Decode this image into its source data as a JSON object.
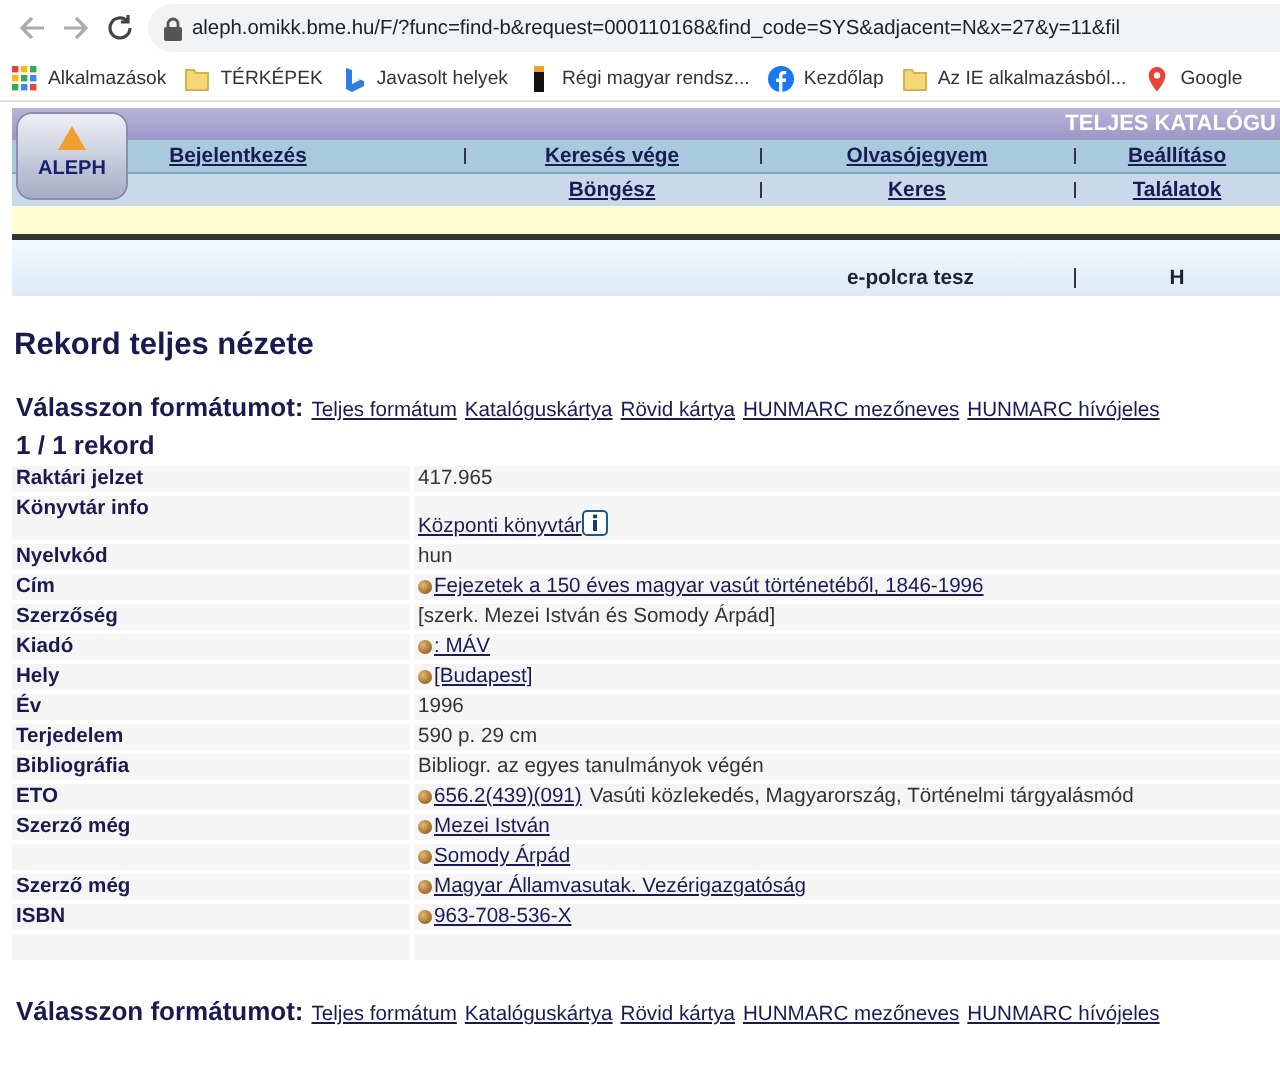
{
  "browser": {
    "url": "aleph.omikk.bme.hu/F/?func=find-b&request=000110168&find_code=SYS&adjacent=N&x=27&y=11&fil",
    "bookmarks": [
      {
        "kind": "apps",
        "label": "Alkalmazások"
      },
      {
        "kind": "folder",
        "label": "TÉRKÉPEK"
      },
      {
        "kind": "bing",
        "label": "Javasolt helyek"
      },
      {
        "kind": "bar",
        "label": "Régi magyar rendsz..."
      },
      {
        "kind": "facebook",
        "label": "Kezdőlap"
      },
      {
        "kind": "folder",
        "label": "Az IE alkalmazásból..."
      },
      {
        "kind": "pin",
        "label": "Google"
      }
    ]
  },
  "header": {
    "logo": "ALEPH",
    "banner": "TELJES KATALÓGU",
    "nav_primary": [
      "Bejelentkezés",
      "Keresés vége",
      "Olvasójegyem",
      "Beállításo"
    ],
    "nav_secondary": [
      "Böngész",
      "Keres",
      "Találatok"
    ],
    "actions": [
      "e-polcra tesz",
      "H"
    ]
  },
  "title": "Rekord teljes nézete",
  "format_selector_top": {
    "label": "Válasszon formátumot:",
    "links": [
      "Teljes formátum",
      "Katalóguskártya",
      "Rövid kártya",
      "HUNMARC mezőneves",
      "HUNMARC hívójeles"
    ]
  },
  "record_count": "1 / 1 rekord",
  "record": [
    {
      "label": "Raktári jelzet",
      "bullet": false,
      "info": false,
      "parts": [
        {
          "kind": "text",
          "text": "417.965"
        }
      ]
    },
    {
      "label": "Könyvtár info",
      "bullet": false,
      "info": true,
      "parts": [
        {
          "kind": "link",
          "text": "Központi könyvtár"
        }
      ]
    },
    {
      "label": "Nyelvkód",
      "bullet": false,
      "info": false,
      "parts": [
        {
          "kind": "text",
          "text": "hun"
        }
      ]
    },
    {
      "label": "Cím",
      "bullet": true,
      "info": false,
      "parts": [
        {
          "kind": "link",
          "text": "Fejezetek a 150 éves magyar vasút történetéből, 1846-1996"
        }
      ]
    },
    {
      "label": "Szerzőség",
      "bullet": false,
      "info": false,
      "parts": [
        {
          "kind": "text",
          "text": "[szerk. Mezei István és Somody Árpád]"
        }
      ]
    },
    {
      "label": "Kiadó",
      "bullet": true,
      "info": false,
      "parts": [
        {
          "kind": "link",
          "text": ": MÁV"
        }
      ]
    },
    {
      "label": "Hely",
      "bullet": true,
      "info": false,
      "parts": [
        {
          "kind": "link",
          "text": "[Budapest]"
        }
      ]
    },
    {
      "label": "Év",
      "bullet": false,
      "info": false,
      "parts": [
        {
          "kind": "text",
          "text": "1996"
        }
      ]
    },
    {
      "label": "Terjedelem",
      "bullet": false,
      "info": false,
      "parts": [
        {
          "kind": "text",
          "text": "590 p. 29 cm"
        }
      ]
    },
    {
      "label": "Bibliográfia",
      "bullet": false,
      "info": false,
      "parts": [
        {
          "kind": "text",
          "text": "Bibliogr. az egyes tanulmányok végén"
        }
      ]
    },
    {
      "label": "ETO",
      "bullet": true,
      "info": false,
      "parts": [
        {
          "kind": "link",
          "text": "656.2(439)(091)"
        },
        {
          "kind": "text",
          "text": "Vasúti közlekedés, Magyarország, Történelmi tárgyalásmód"
        }
      ]
    },
    {
      "label": "Szerző még",
      "bullet": true,
      "info": false,
      "parts": [
        {
          "kind": "link",
          "text": "Mezei István"
        }
      ]
    },
    {
      "bullet": true,
      "info": false,
      "parts": [
        {
          "kind": "link",
          "text": "Somody Árpád"
        }
      ]
    },
    {
      "label": "Szerző még",
      "bullet": true,
      "info": false,
      "parts": [
        {
          "kind": "link",
          "text": "Magyar Államvasutak. Vezérigazgatóság"
        }
      ]
    },
    {
      "label": "ISBN",
      "bullet": true,
      "info": false,
      "parts": [
        {
          "kind": "link",
          "text": "963-708-536-X"
        }
      ]
    }
  ],
  "format_selector_bottom": {
    "label": "Válasszon formátumot:",
    "links": [
      "Teljes formátum",
      "Katalóguskártya",
      "Rövid kártya",
      "HUNMARC mezőneves",
      "HUNMARC hívójeles"
    ]
  }
}
